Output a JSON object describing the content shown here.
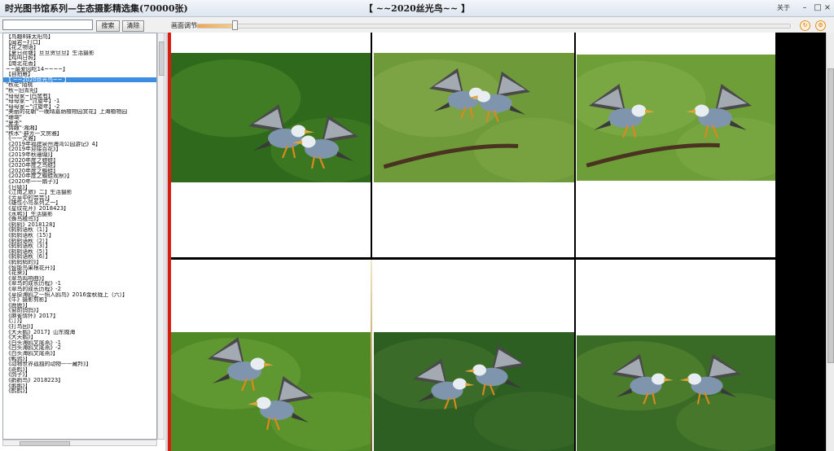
{
  "app": {
    "title": "时光图书馆系列—生态摄影精选集(70000张)",
    "album_title": "【 ~~2020丝光鸟~~ 】",
    "about": "关于",
    "window_controls": [
      "–",
      "□",
      "×"
    ]
  },
  "toolbar": {
    "search_value": "",
    "search_button": "搜索",
    "clear_button": "清除",
    "slider_label": "画面调节",
    "slider_value": 0.06,
    "icons": [
      "refresh-icon",
      "settings-icon"
    ]
  },
  "sidebar": {
    "selected_index": 8,
    "items": [
      "【鸟趣8妹太阳鸟】",
      "【闻君~打口】",
      "【花之物语】",
      "【夏日荷塘】旦旦贺旦旦】生活摄影",
      "【鸡叫日照】",
      "【南北花香】",
      "~~最爱园吃14~~~~】",
      "【自拍雁】",
      "【 ~~2020丝光鸟~~ 】",
      "\"秋花\"陌桃",
      "\"秋~旧青阳】",
      "\"母母家~|白鹭有】",
      "\"母母家~\"讨旋年】-1",
      "\"母母家~\"讨旋年】-2",
      "\"美丽的花朝\"—晚晴嘉荫植物园赏花】上海植物园",
      "\"珊瑚\"",
      "\"夏季\"",
      "\"情趣\"·湘湘】",
      "\"秩水\"·群芳—文房雅】",
      "《一一文雅】",
      "《2019年福建泉州海湾公园游记》4】",
      "《2019年迎接百花》】",
      "《2019年秋珊瑚》】",
      "《2020年度之蛙蛙】",
      "《2020年度之鸟蛙】",
      "《2020年度之蟾蛙】",
      "《2020年度之蟾蛙观察》】",
      "《2020年一一扇子》】",
      "《日级》】",
      "《江南之旅》二】生活摄影",
      "《芳草中的芸芸》】",
      "《雄性小鸟系列之一】",
      "《星纹花开》2018423】",
      "《水鸭》】生活摄影",
      "《蜂鸟植鸟》】",
      "《鸫鸫》2018128】",
      "《鸫鸫语秋（1）】",
      "《鸫鸫语秋（15）】",
      "《鸫鸫语秋（2）】",
      "《鸫鸫语秋（3）】",
      "《鸫鸫语秋（5）】",
      "《鸫鸫语秋（6）】",
      "《鸫鸫鸫的》】",
      "《智能鸟果根花开》】",
      "《花葵》】",
      "《翠鸟鸣响曲》】",
      "《翠鸟的成长历程》-1",
      "《翠鸟的成长历程》-2",
      "《草原海鸥之—照人鸥鸟》2016金秋陇上（六）】",
      "《牛》摄影剪影】",
      "《鹿鹿》】",
      "《窗前鸽鸽》】",
      "《麻雀情怀》2017】",
      "《汀》】",
      "《打鸟回》】",
      "《大天鹅》2017】山东威海",
      "《大天鹅》】",
      "《白头海鸥叉尾燕》-1",
      "《白头海鸥叉尾燕》-2",
      "《白头海鸥叉尾燕》】",
      "《鹌鹑》】",
      "《动物世界孤独的动物——藏羚》】",
      "《斑鹤》】",
      "《鸽子》】",
      "《鹳鹳鸟》2018223】",
      "《鹅鹅》】",
      "《鹤鹤》】"
    ]
  },
  "gallery": {
    "photos": [
      {
        "name": "photo-two-starlings-dancing",
        "bg": "#2f6a1c",
        "ground": "#4d8a2a"
      },
      {
        "name": "photo-pair-on-branch-meadow",
        "bg": "#6f9a3a",
        "ground": "#86ad4c"
      },
      {
        "name": "photo-two-starlings-perched",
        "bg": "#6e9e38",
        "ground": "#84b04a"
      },
      {
        "name": "photo-starlings-midair-chase",
        "bg": "#4f8a26",
        "ground": "#6ea338"
      },
      {
        "name": "photo-starlings-in-flight-forest",
        "bg": "#2d5e22",
        "ground": "#47762f"
      },
      {
        "name": "photo-starlings-facing-off",
        "bg": "#3a6b26",
        "ground": "#5a8a32"
      }
    ]
  },
  "colors": {
    "accent_red": "#d81c12",
    "slider_orange": "#f2a54a",
    "selection_blue": "#3d8ee0"
  }
}
